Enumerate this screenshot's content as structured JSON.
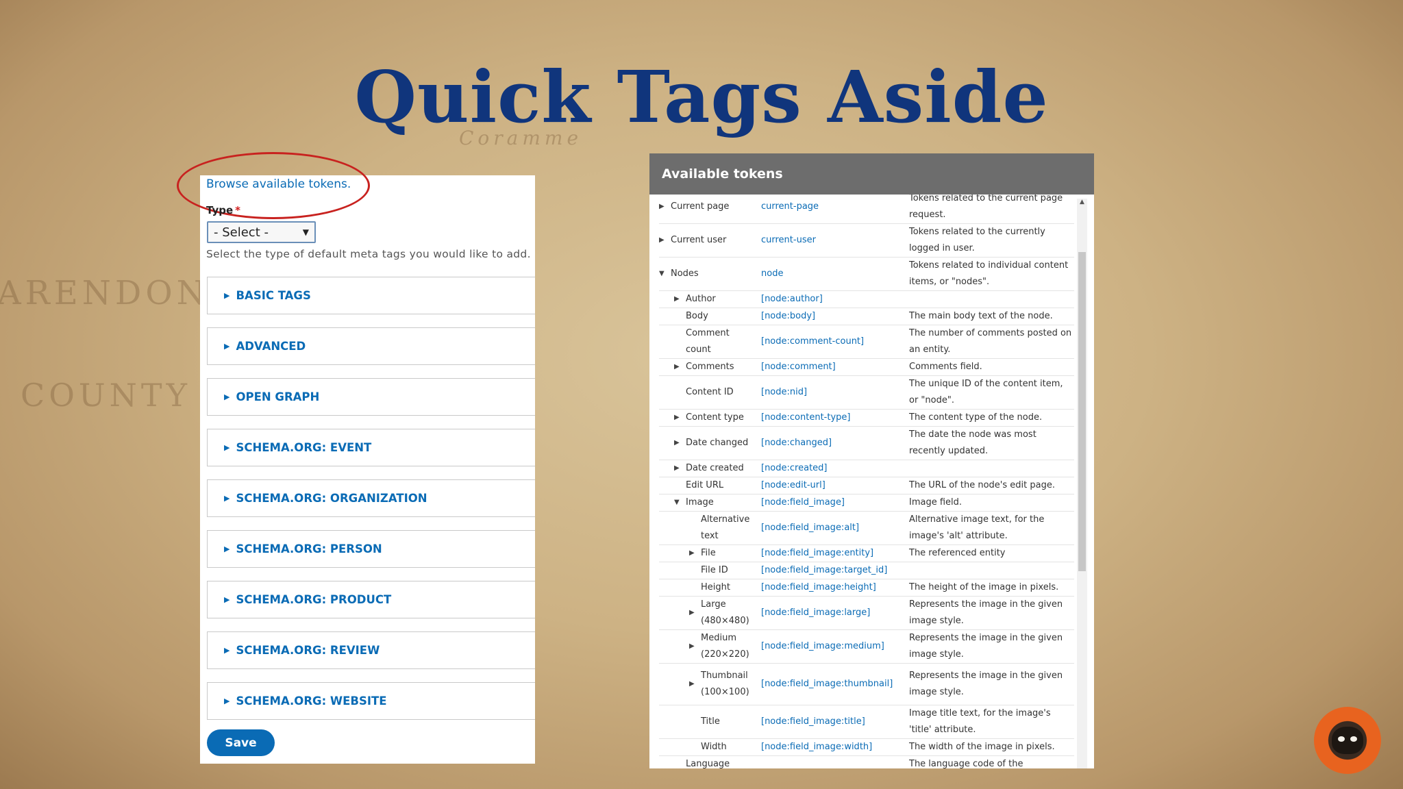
{
  "slide": {
    "title": "Quick Tags Aside"
  },
  "form": {
    "browse_link": "Browse available tokens.",
    "type_label": "Type",
    "required_mark": "*",
    "select_value": "- Select -",
    "help_text": "Select the type of default meta tags you would like to add.",
    "sections": [
      "BASIC TAGS",
      "ADVANCED",
      "OPEN GRAPH",
      "SCHEMA.ORG: EVENT",
      "SCHEMA.ORG: ORGANIZATION",
      "SCHEMA.ORG: PERSON",
      "SCHEMA.ORG: PRODUCT",
      "SCHEMA.ORG: REVIEW",
      "SCHEMA.ORG: WEBSITE"
    ],
    "save_label": "Save"
  },
  "tokens": {
    "title": "Available tokens",
    "rows": [
      {
        "name": "Current page",
        "token": "current-page",
        "desc": "Tokens related to the current page request.",
        "indent": 0,
        "expander": "collapsed"
      },
      {
        "name": "Current user",
        "token": "current-user",
        "desc": "Tokens related to the currently logged in user.",
        "indent": 0,
        "expander": "collapsed"
      },
      {
        "name": "Nodes",
        "token": "node",
        "desc": "Tokens related to individual content items, or \"nodes\".",
        "indent": 0,
        "expander": "expanded"
      },
      {
        "name": "Author",
        "token": "[node:author]",
        "desc": "",
        "indent": 1,
        "expander": "collapsed"
      },
      {
        "name": "Body",
        "token": "[node:body]",
        "desc": "The main body text of the node.",
        "indent": 1,
        "expander": "none"
      },
      {
        "name": "Comment count",
        "token": "[node:comment-count]",
        "desc": "The number of comments posted on an entity.",
        "indent": 1,
        "expander": "none"
      },
      {
        "name": "Comments",
        "token": "[node:comment]",
        "desc": "Comments field.",
        "indent": 1,
        "expander": "collapsed"
      },
      {
        "name": "Content ID",
        "token": "[node:nid]",
        "desc": "The unique ID of the content item, or \"node\".",
        "indent": 1,
        "expander": "none"
      },
      {
        "name": "Content type",
        "token": "[node:content-type]",
        "desc": "The content type of the node.",
        "indent": 1,
        "expander": "collapsed"
      },
      {
        "name": "Date changed",
        "token": "[node:changed]",
        "desc": "The date the node was most recently updated.",
        "indent": 1,
        "expander": "collapsed"
      },
      {
        "name": "Date created",
        "token": "[node:created]",
        "desc": "",
        "indent": 1,
        "expander": "collapsed"
      },
      {
        "name": "Edit URL",
        "token": "[node:edit-url]",
        "desc": "The URL of the node's edit page.",
        "indent": 1,
        "expander": "none"
      },
      {
        "name": "Image",
        "token": "[node:field_image]",
        "desc": "Image field.",
        "indent": 1,
        "expander": "expanded"
      },
      {
        "name": "Alternative text",
        "token": "[node:field_image:alt]",
        "desc": "Alternative image text, for the image's 'alt' attribute.",
        "indent": 2,
        "expander": "none"
      },
      {
        "name": "File",
        "token": "[node:field_image:entity]",
        "desc": "The referenced entity",
        "indent": 2,
        "expander": "collapsed"
      },
      {
        "name": "File ID",
        "token": "[node:field_image:target_id]",
        "desc": "",
        "indent": 2,
        "expander": "none"
      },
      {
        "name": "Height",
        "token": "[node:field_image:height]",
        "desc": "The height of the image in pixels.",
        "indent": 2,
        "expander": "none"
      },
      {
        "name": "Large (480×480)",
        "token": "[node:field_image:large]",
        "desc": "Represents the image in the given image style.",
        "indent": 2,
        "expander": "collapsed"
      },
      {
        "name": "Medium (220×220)",
        "token": "[node:field_image:medium]",
        "desc": "Represents the image in the given image style.",
        "indent": 2,
        "expander": "collapsed"
      },
      {
        "name": "Thumbnail (100×100)",
        "token": "[node:field_image:thumbnail]",
        "desc": "Represents the image in the given image style.",
        "indent": 2,
        "expander": "collapsed"
      },
      {
        "name": "Title",
        "token": "[node:field_image:title]",
        "desc": "Image title text, for the image's 'title' attribute.",
        "indent": 2,
        "expander": "none"
      },
      {
        "name": "Width",
        "token": "[node:field_image:width]",
        "desc": "The width of the image in pixels.",
        "indent": 2,
        "expander": "none"
      },
      {
        "name": "Language",
        "token": "",
        "desc": "The language code of the",
        "indent": 1,
        "expander": "none"
      }
    ]
  },
  "icons": {
    "collapsed": "▶",
    "expanded": "▼",
    "select_caret": "▼",
    "scroll_up": "▲"
  },
  "colors": {
    "title": "#10357c",
    "link": "#0a6bb5",
    "annotation": "#c8221f",
    "dialog_header": "#6d6d6d"
  }
}
